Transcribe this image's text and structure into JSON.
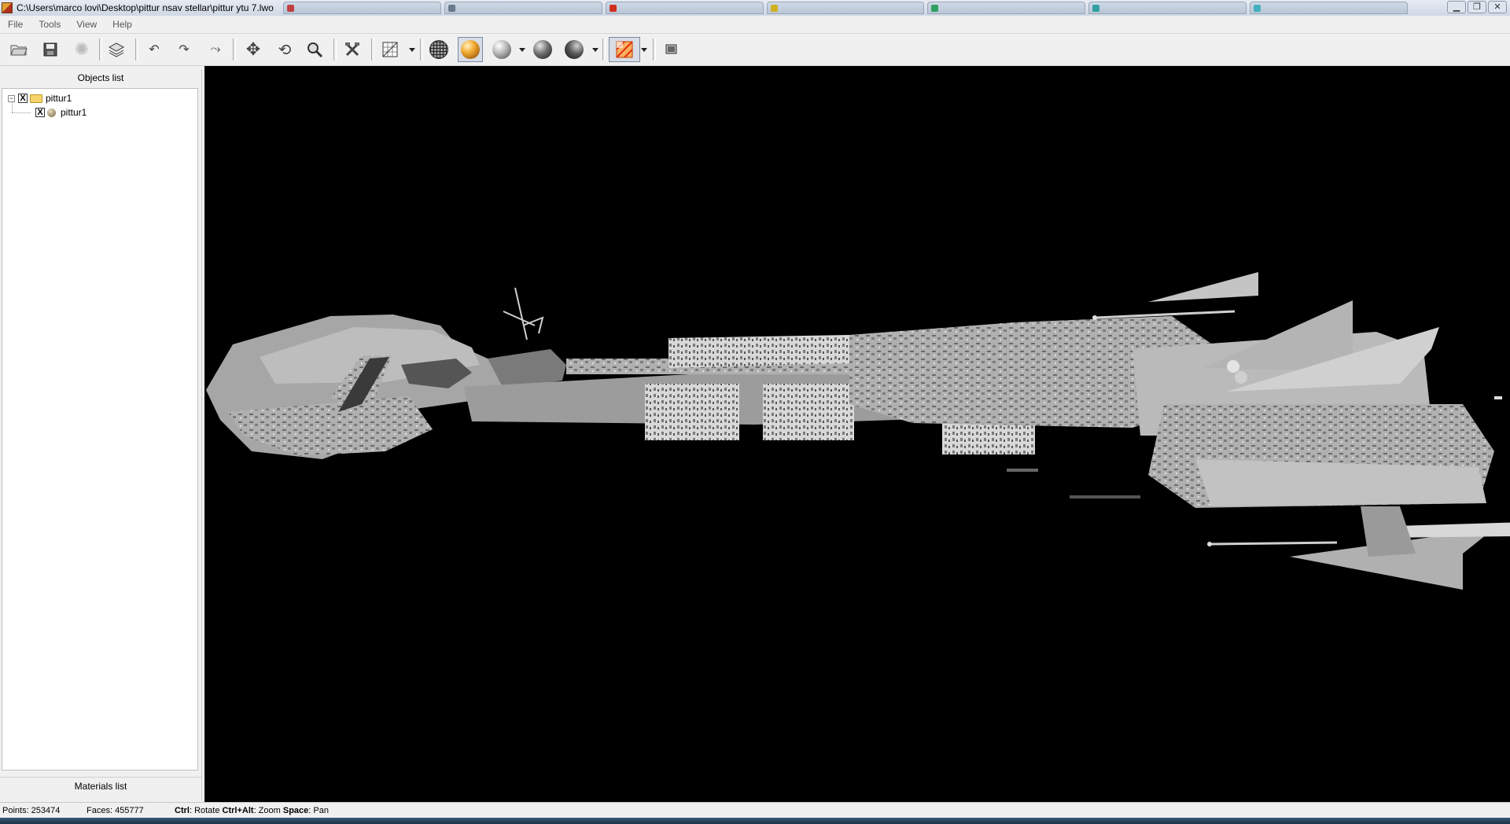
{
  "window": {
    "title": "C:\\Users\\marco lovi\\Desktop\\pittur nsav stellar\\pittur ytu 7.lwo",
    "minimize_icon": "minimize-icon",
    "maximize_icon": "restore-icon",
    "close_icon": "close-icon",
    "background_tab_colors": [
      "#c04040",
      "#6a7a8a",
      "#d03020",
      "#d0b020",
      "#30a060",
      "#30a0a0",
      "#40b0c0"
    ]
  },
  "menu": [
    {
      "label": "File"
    },
    {
      "label": "Tools"
    },
    {
      "label": "View"
    },
    {
      "label": "Help"
    }
  ],
  "toolbar": {
    "buttons": [
      {
        "icon": "open-folder-icon"
      },
      {
        "icon": "save-icon"
      },
      {
        "icon": "settings-gear-icon"
      },
      {
        "icon": "layers-icon"
      },
      {
        "icon": "undo-icon"
      },
      {
        "icon": "redo-icon"
      },
      {
        "icon": "reset-icon"
      },
      {
        "icon": "move-icon"
      },
      {
        "icon": "rotate-icon"
      },
      {
        "icon": "zoom-icon"
      },
      {
        "icon": "tools-hammer-icon"
      },
      {
        "icon": "grid-texture-icon"
      },
      {
        "icon": "wireframe-sphere-icon"
      },
      {
        "icon": "shaded-sphere-icon"
      },
      {
        "icon": "smooth-sphere-icon"
      },
      {
        "icon": "flat-sphere-icon"
      },
      {
        "icon": "dark-sphere-icon"
      },
      {
        "icon": "texture-pattern-icon"
      },
      {
        "icon": "screen-icon"
      }
    ]
  },
  "objects_panel": {
    "header": "Objects list",
    "tree": [
      {
        "label": "pittur1",
        "type": "group",
        "checked": true,
        "expanded": true
      },
      {
        "label": "pittur1",
        "type": "mesh",
        "checked": true
      }
    ],
    "check_glyph": "X",
    "expander_glyph": "−"
  },
  "materials_panel": {
    "header": "Materials list"
  },
  "status": {
    "points": "Points: 253474",
    "faces": "Faces: 455777",
    "hint_ctrl_key": "Ctrl",
    "hint_ctrl_action": ": Rotate ",
    "hint_zoom_key": "Ctrl+Alt",
    "hint_zoom_action": ": Zoom ",
    "hint_pan_key": "Space",
    "hint_pan_action": ": Pan"
  },
  "viewport": {
    "background": "#000000",
    "model_color": "#a8a8a8"
  }
}
